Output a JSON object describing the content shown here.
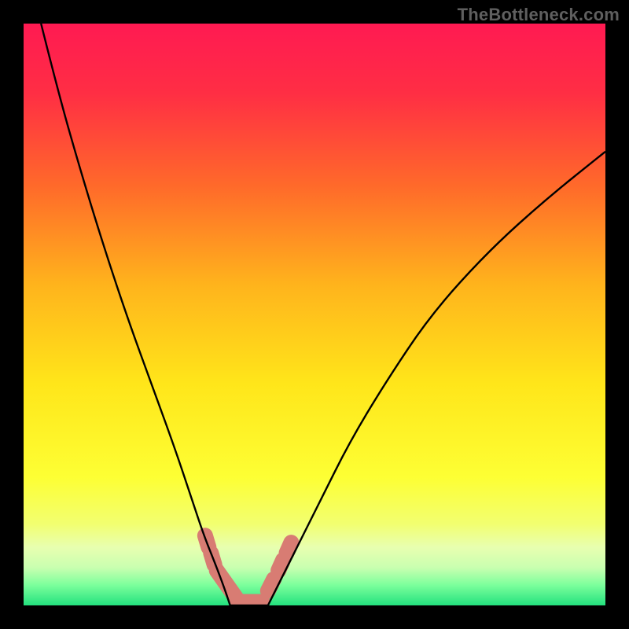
{
  "watermark": "TheBottleneck.com",
  "chart_data": {
    "type": "line",
    "title": "",
    "xlabel": "",
    "ylabel": "",
    "xlim": [
      0,
      100
    ],
    "ylim": [
      0,
      100
    ],
    "grid": false,
    "legend": false,
    "background_gradient": [
      {
        "pos": 0.0,
        "color": "#ff1a52"
      },
      {
        "pos": 0.12,
        "color": "#ff2e44"
      },
      {
        "pos": 0.28,
        "color": "#ff6a2a"
      },
      {
        "pos": 0.45,
        "color": "#ffb41c"
      },
      {
        "pos": 0.62,
        "color": "#ffe61a"
      },
      {
        "pos": 0.78,
        "color": "#fdff34"
      },
      {
        "pos": 0.86,
        "color": "#f2ff70"
      },
      {
        "pos": 0.9,
        "color": "#e8ffb0"
      },
      {
        "pos": 0.935,
        "color": "#c9ffb0"
      },
      {
        "pos": 0.965,
        "color": "#7cff9c"
      },
      {
        "pos": 1.0,
        "color": "#23e17e"
      }
    ],
    "series": [
      {
        "name": "left-curve",
        "x": [
          3,
          6,
          10,
          14,
          18,
          22,
          26,
          29,
          31,
          33,
          34.5,
          35.5
        ],
        "y": [
          100,
          88,
          74,
          61,
          49,
          38,
          27,
          18,
          12,
          7,
          3,
          0
        ]
      },
      {
        "name": "right-curve",
        "x": [
          42,
          44,
          47,
          51,
          56,
          62,
          70,
          80,
          90,
          100
        ],
        "y": [
          0,
          4,
          10,
          18,
          28,
          38,
          50,
          61,
          70,
          78
        ]
      },
      {
        "name": "trough-floor",
        "x": [
          35.5,
          42
        ],
        "y": [
          0,
          0
        ]
      }
    ],
    "markers": {
      "name": "trough-markers-salmon",
      "color": "#d87c73",
      "capsule_radius_px": 10,
      "segments": [
        {
          "x1": 31.2,
          "y1": 12.0,
          "x2": 31.8,
          "y2": 10.0
        },
        {
          "x1": 32.2,
          "y1": 9.0,
          "x2": 32.8,
          "y2": 7.0
        },
        {
          "x1": 33.2,
          "y1": 6.0,
          "x2": 37.0,
          "y2": 0.6
        },
        {
          "x1": 37.0,
          "y1": 0.6,
          "x2": 41.0,
          "y2": 0.6
        },
        {
          "x1": 42.0,
          "y1": 2.5,
          "x2": 43.0,
          "y2": 4.5
        },
        {
          "x1": 43.8,
          "y1": 6.0,
          "x2": 44.6,
          "y2": 7.8
        },
        {
          "x1": 45.2,
          "y1": 9.0,
          "x2": 46.0,
          "y2": 10.8
        }
      ]
    }
  }
}
